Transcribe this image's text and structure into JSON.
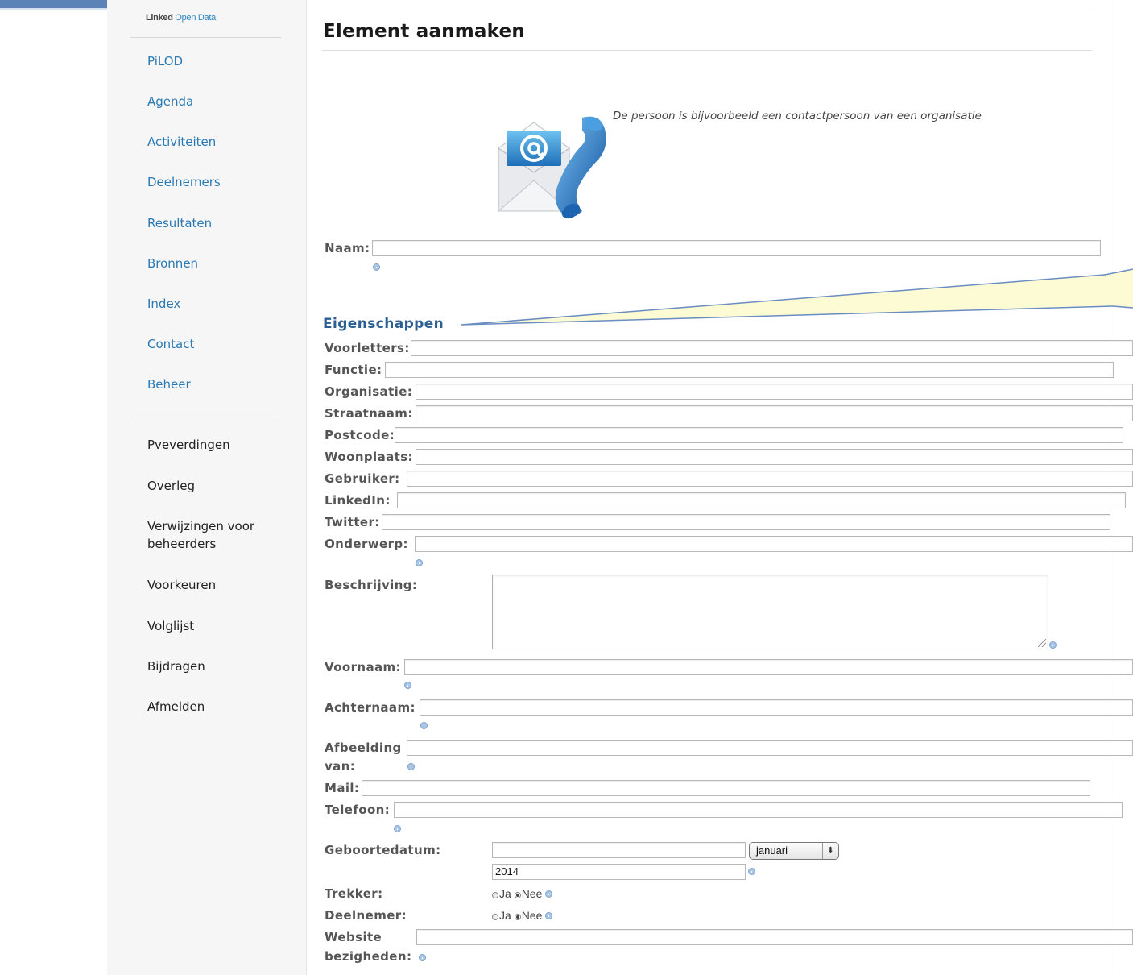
{
  "sidebar": {
    "logo_a": "Linked",
    "logo_b": "Open Data",
    "nav": [
      {
        "label": "PiLOD"
      },
      {
        "label": "Agenda"
      },
      {
        "label": "Activiteiten"
      },
      {
        "label": "Deelnemers"
      },
      {
        "label": "Resultaten"
      },
      {
        "label": "Bronnen"
      },
      {
        "label": "Index"
      },
      {
        "label": "Contact"
      },
      {
        "label": "Beheer"
      }
    ],
    "user": [
      {
        "label": "Pveverdingen"
      },
      {
        "label": "Overleg"
      },
      {
        "label": "Verwijzingen voor beheerders"
      },
      {
        "label": "Voorkeuren"
      },
      {
        "label": "Volglijst"
      },
      {
        "label": "Bijdragen"
      },
      {
        "label": "Afmelden"
      }
    ]
  },
  "page": {
    "title": "Element aanmaken",
    "caption": "De persoon is bijvoorbeeld een contactpersoon van een organisatie",
    "section": "Eigenschappen"
  },
  "form": {
    "naam": "Naam:",
    "voorletters": "Voorletters:",
    "functie": "Functie:",
    "organisatie": "Organisatie:",
    "straatnaam": "Straatnaam:",
    "postcode": "Postcode:",
    "woonplaats": "Woonplaats:",
    "gebruiker": "Gebruiker:",
    "linkedin": "LinkedIn:",
    "twitter": "Twitter:",
    "onderwerp": "Onderwerp:",
    "beschrijving": "Beschrijving:",
    "voornaam": "Voornaam:",
    "achternaam": "Achternaam:",
    "afbeelding_1": "Afbeelding",
    "afbeelding_2": "van:",
    "mail": "Mail:",
    "telefoon": "Telefoon:",
    "geboortedatum": "Geboortedatum:",
    "month_selected": "januari",
    "year_value": "2014",
    "trekker": "Trekker:",
    "deelnemer": "Deelnemer:",
    "ja": "Ja",
    "nee": "Nee",
    "website_1": "Website",
    "website_2": "bezigheden:"
  },
  "colors": {
    "link": "#2a79b5",
    "section": "#2a5f94",
    "callout_fill": "#fdfbd4",
    "topbar": "#5b83b8"
  }
}
